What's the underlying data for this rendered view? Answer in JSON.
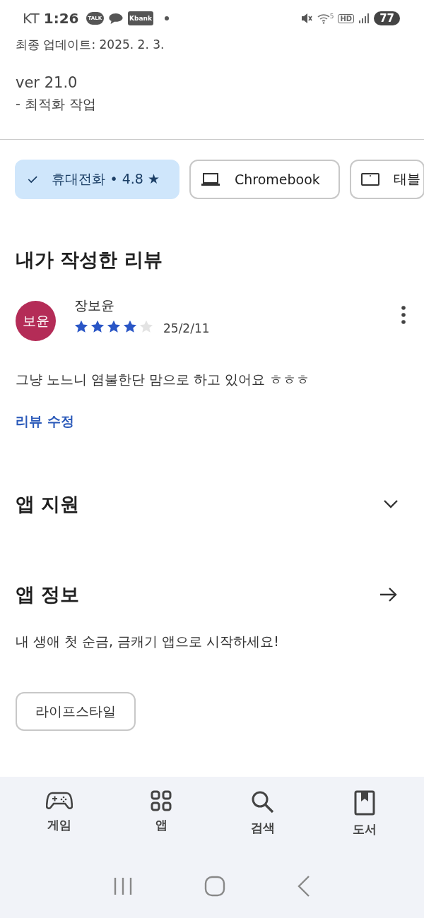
{
  "status_bar": {
    "carrier": "KT",
    "time": "1:26",
    "notifications": [
      {
        "kind": "talk",
        "label": "TALK"
      },
      {
        "kind": "bubble"
      },
      {
        "kind": "bank",
        "label": "Kbank"
      }
    ],
    "wifi_band": "5",
    "hd": "HD",
    "battery": "77"
  },
  "update": {
    "date_line": "최종 업데이트: 2025. 2. 3.",
    "version": "ver 21.0",
    "notes": "- 최적화 작업"
  },
  "device_chips": [
    {
      "kind": "phone",
      "label": "휴대전화 • 4.8 ★",
      "selected": true
    },
    {
      "kind": "laptop",
      "label": "Chromebook",
      "selected": false
    },
    {
      "kind": "tablet",
      "label": "태블",
      "selected": false
    }
  ],
  "my_review": {
    "heading": "내가 작성한 리뷰",
    "avatar": "보윤",
    "author": "장보윤",
    "stars": 4,
    "date": "25/2/11",
    "text": "그냥 노느니 염불한단 맘으로 하고 있어요 ㅎㅎㅎ",
    "edit_link": "리뷰 수정"
  },
  "app_support": {
    "title": "앱 지원",
    "expanded": false
  },
  "app_info": {
    "title": "앱 정보",
    "description": "내 생애 첫 순금, 금캐기 앱으로 시작하세요!",
    "tag": "라이프스타일"
  },
  "bottom_nav": [
    {
      "kind": "games",
      "label": "게임",
      "selected": false
    },
    {
      "kind": "apps",
      "label": "앱",
      "selected": false
    },
    {
      "kind": "search",
      "label": "검색",
      "selected": false
    },
    {
      "kind": "books",
      "label": "도서",
      "selected": false
    }
  ]
}
